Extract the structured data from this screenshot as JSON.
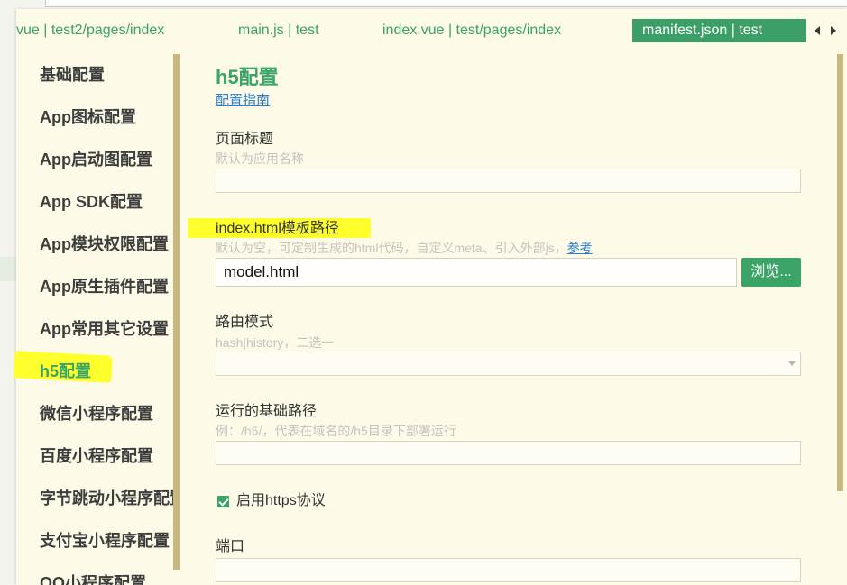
{
  "colors": {
    "background": "#fdfbe7",
    "accent": "#3aa365",
    "active_tab_bg": "#3c9f67",
    "link": "#2b7bd1",
    "highlight": "#ffff2b",
    "scrollbar": "#c9b87e"
  },
  "tabs": [
    {
      "label": "vue | test2/pages/index",
      "active": false
    },
    {
      "label": "main.js | test",
      "active": false
    },
    {
      "label": "index.vue | test/pages/index",
      "active": false
    },
    {
      "label": "manifest.json | test",
      "active": true
    }
  ],
  "tab_scroll": {
    "prev_icon": "triangle-left-icon",
    "next_icon": "triangle-right-icon"
  },
  "sidebar": {
    "active_index": 7,
    "items": [
      {
        "label": "基础配置"
      },
      {
        "label": "App图标配置"
      },
      {
        "label": "App启动图配置"
      },
      {
        "label": "App SDK配置"
      },
      {
        "label": "App模块权限配置"
      },
      {
        "label": "App原生插件配置"
      },
      {
        "label": "App常用其它设置"
      },
      {
        "label": "h5配置"
      },
      {
        "label": "微信小程序配置"
      },
      {
        "label": "百度小程序配置"
      },
      {
        "label": "字节跳动小程序配置"
      },
      {
        "label": "支付宝小程序配置"
      },
      {
        "label": "QQ小程序配置"
      }
    ]
  },
  "main": {
    "title": "h5配置",
    "guide_link": "配置指南",
    "page_title": {
      "label": "页面标题",
      "hint": "默认为应用名称",
      "value": ""
    },
    "template_path": {
      "label": "index.html模板路径",
      "hint": "默认为空，可定制生成的html代码，自定义meta、引入外部js，",
      "hint_link": "参考",
      "value": "model.html",
      "browse_label": "浏览..."
    },
    "router_mode": {
      "label": "路由模式",
      "hint": "hash|history，二选一",
      "value": "",
      "dropdown_icon": "caret-down-icon"
    },
    "base_path": {
      "label": "运行的基础路径",
      "hint": "例：/h5/，代表在域名的/h5目录下部署运行",
      "value": ""
    },
    "https": {
      "label": "启用https协议",
      "checked": true
    },
    "port": {
      "label": "端口",
      "value": ""
    }
  }
}
